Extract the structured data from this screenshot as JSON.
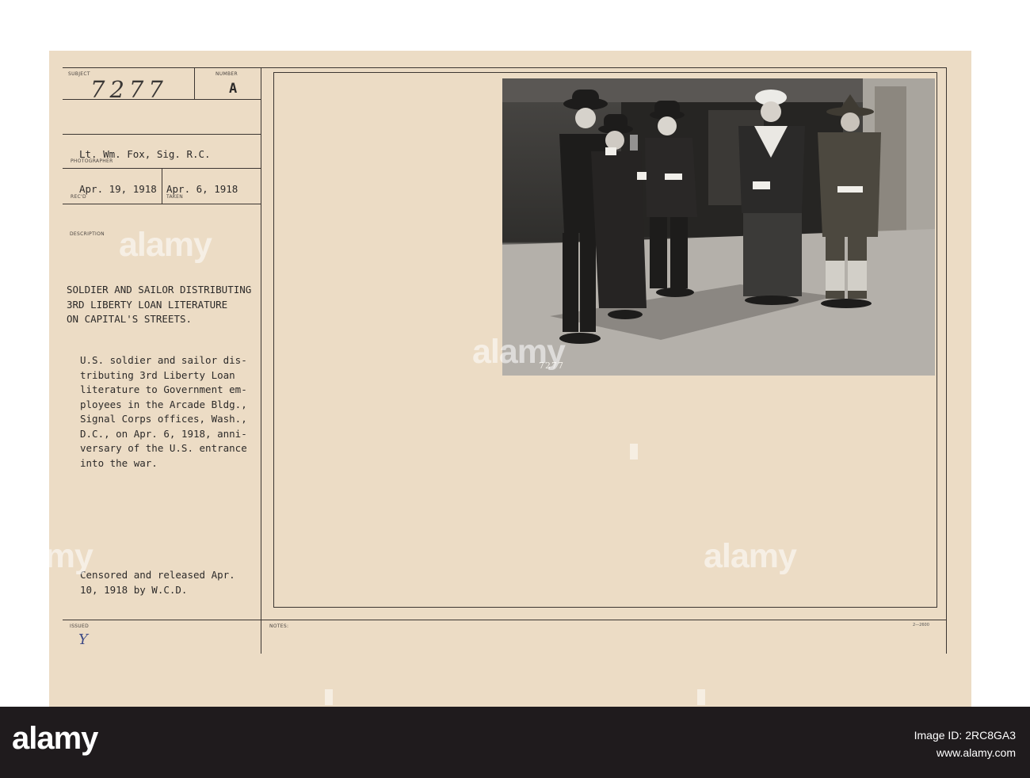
{
  "card": {
    "labels": {
      "subject": "SUBJECT",
      "number": "NUMBER",
      "photographer": "PHOTOGRAPHER",
      "recd": "REC'D",
      "taken": "TAKEN",
      "description": "DESCRIPTION",
      "issued": "ISSUED",
      "notes": "NOTES:"
    },
    "subject_number": "7277",
    "number_letter": "A",
    "photographer_name": "Lt. Wm. Fox, Sig. R.C.",
    "received_date": "Apr. 19, 1918",
    "taken_date": "Apr. 6, 1918",
    "headline": "SOLDIER AND SAILOR DISTRIBUTING\n3RD LIBERTY LOAN LITERATURE\nON CAPITAL'S STREETS.",
    "description": "U.S. soldier and sailor dis-\ntributing 3rd Liberty Loan\nliterature to Government em-\nployees in the Arcade Bldg.,\nSignal Corps offices, Wash.,\nD.C., on Apr. 6, 1918, anni-\nversary of the U.S. entrance\ninto the war.",
    "censor_note": "Censored and released Apr.\n10, 1918 by W.C.D.",
    "issued_mark": "Y",
    "form_number": "2—2600",
    "photo_inscription": "7277"
  },
  "watermarks": {
    "text": "alamy"
  },
  "footer": {
    "brand": "alamy",
    "image_id_label": "Image ID: 2RC8GA3",
    "url": "www.alamy.com"
  },
  "colors": {
    "card": "#ecdcc5",
    "strip": "#1f1b1d",
    "ink": "#2c2a29"
  }
}
